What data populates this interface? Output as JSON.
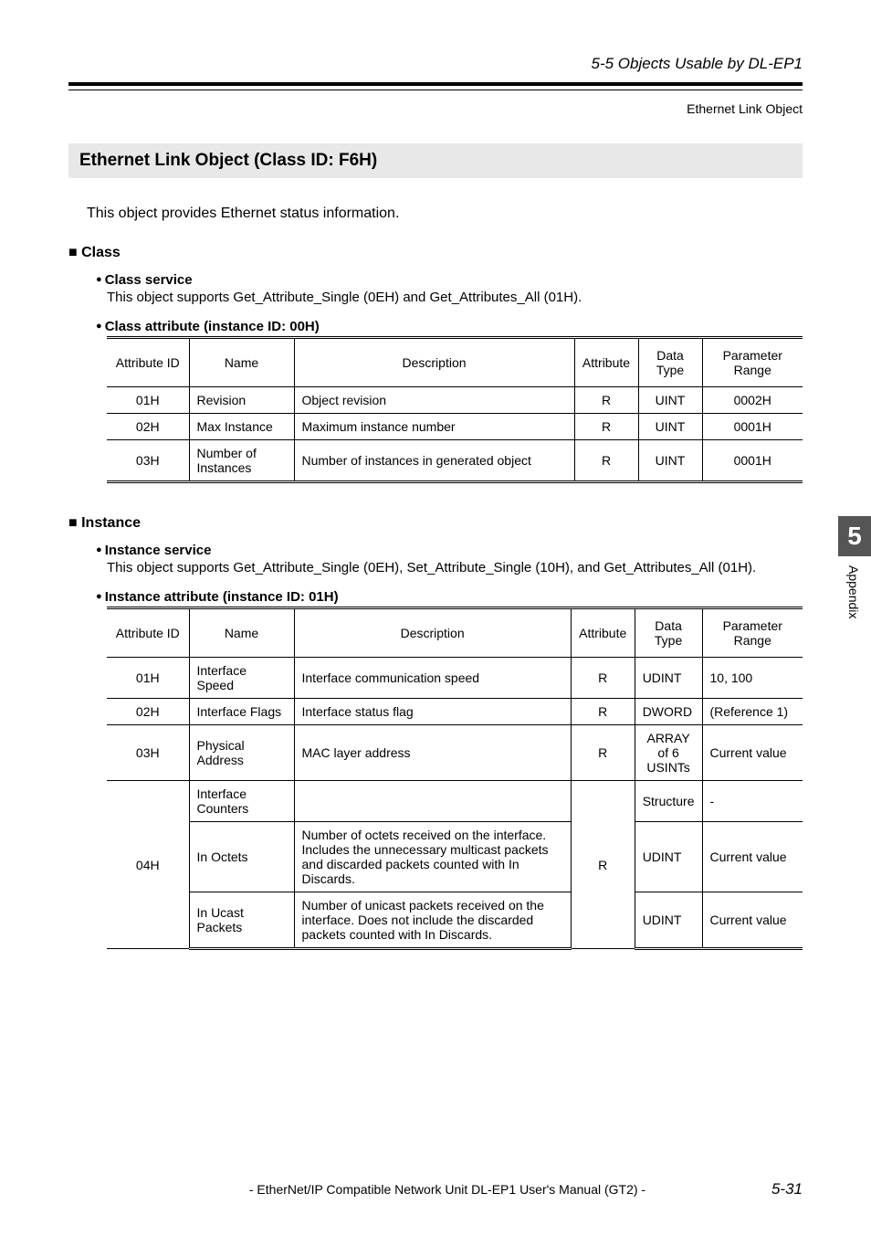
{
  "header": {
    "section_title": "5-5 Objects Usable by DL-EP1",
    "subtitle": "Ethernet Link Object"
  },
  "title": "Ethernet Link Object (Class ID: F6H)",
  "intro": "This object provides Ethernet status information.",
  "class_section": {
    "label": "Class",
    "service_label": "Class service",
    "service_text": "This object supports Get_Attribute_Single (0EH) and Get_Attributes_All (01H).",
    "attr_label": "Class attribute (instance ID: 00H)",
    "headers": [
      "Attribute ID",
      "Name",
      "Description",
      "Attribute",
      "Data Type",
      "Parameter Range"
    ],
    "rows": [
      {
        "id": "01H",
        "name": "Revision",
        "desc": "Object revision",
        "attr": "R",
        "type": "UINT",
        "range": "0002H"
      },
      {
        "id": "02H",
        "name": "Max Instance",
        "desc": "Maximum instance number",
        "attr": "R",
        "type": "UINT",
        "range": "0001H"
      },
      {
        "id": "03H",
        "name": "Number of Instances",
        "desc": "Number of instances in generated object",
        "attr": "R",
        "type": "UINT",
        "range": "0001H"
      }
    ]
  },
  "instance_section": {
    "label": "Instance",
    "service_label": "Instance service",
    "service_text": "This object supports Get_Attribute_Single (0EH), Set_Attribute_Single (10H), and Get_Attributes_All (01H).",
    "attr_label": "Instance attribute (instance ID: 01H)",
    "headers": [
      "Attribute ID",
      "Name",
      "Description",
      "Attribute",
      "Data Type",
      "Parameter Range"
    ],
    "rows": [
      {
        "id": "01H",
        "name": "Interface Speed",
        "desc": "Interface communication speed",
        "attr": "R",
        "type": "UDINT",
        "range": "10, 100"
      },
      {
        "id": "02H",
        "name": "Interface Flags",
        "desc": "Interface status flag",
        "attr": "R",
        "type": "DWORD",
        "range": "(Reference 1)"
      },
      {
        "id": "03H",
        "name": "Physical Address",
        "desc": "MAC layer address",
        "attr": "R",
        "type": "ARRAY of 6 USINTs",
        "range": "Current value"
      }
    ],
    "row04": {
      "id": "04H",
      "attr": "R",
      "sub": [
        {
          "name": "Interface Counters",
          "desc": "",
          "type": "Structure",
          "range": "-"
        },
        {
          "name": "In Octets",
          "desc": "Number of octets received on the interface. Includes the unnecessary multicast packets and discarded packets counted with In Discards.",
          "type": "UDINT",
          "range": "Current value"
        },
        {
          "name": "In Ucast Packets",
          "desc": "Number of unicast packets received on the interface. Does not include the discarded packets counted with In Discards.",
          "type": "UDINT",
          "range": "Current value"
        }
      ]
    }
  },
  "sidebar": {
    "chapter": "5",
    "label": "Appendix"
  },
  "footer": {
    "title": "- EtherNet/IP Compatible Network Unit DL-EP1 User's Manual (GT2) -",
    "page": "5-31"
  }
}
